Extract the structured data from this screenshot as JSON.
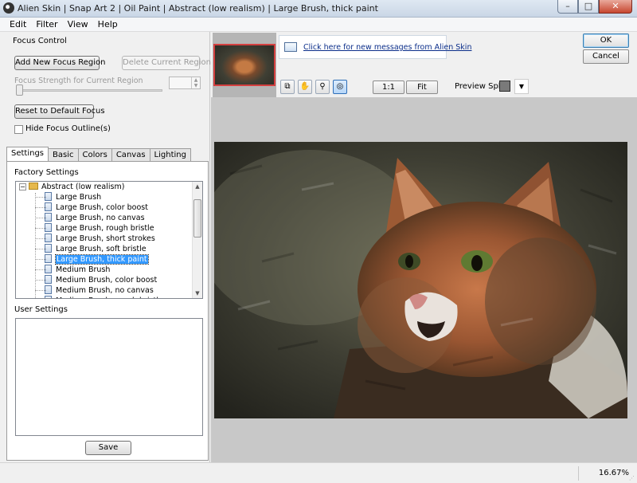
{
  "window": {
    "title": "Alien Skin | Snap Art 2 | Oil Paint | Abstract (low realism) | Large Brush, thick paint",
    "min_label": "–",
    "max_label": "□",
    "close_label": "✕"
  },
  "menu": [
    "Edit",
    "Filter",
    "View",
    "Help"
  ],
  "focus_control": {
    "group_label": "Focus Control",
    "add_region": "Add New Focus Region",
    "delete_region": "Delete Current Region",
    "strength_label": "Focus Strength for Current Region",
    "reset": "Reset to Default Focus",
    "hide_outline": "Hide Focus Outline(s)"
  },
  "tabs": [
    "Settings",
    "Basic",
    "Colors",
    "Canvas",
    "Lighting"
  ],
  "settings": {
    "factory_label": "Factory Settings",
    "tree_folder": "Abstract (low realism)",
    "tree_items": [
      "Large Brush",
      "Large Brush, color boost",
      "Large Brush, no canvas",
      "Large Brush, rough bristle",
      "Large Brush, short strokes",
      "Large Brush, soft bristle",
      "Large Brush, thick paint",
      "Medium Brush",
      "Medium Brush, color boost",
      "Medium Brush, no canvas",
      "Medium Brush, rough bristle"
    ],
    "selected_item": "Large Brush, thick paint",
    "user_label": "User Settings",
    "save": "Save"
  },
  "preview": {
    "message_link": "Click here for new messages from Alien Skin",
    "ok": "OK",
    "cancel": "Cancel",
    "zoom_1to1": "1:1",
    "fit": "Fit",
    "preview_split_label": "Preview Split:",
    "split_color": "#7a7a7a",
    "tools": [
      "compare-icon",
      "hand-icon",
      "zoom-icon",
      "focus-target-icon"
    ]
  },
  "status": {
    "zoom": "16.67%"
  }
}
